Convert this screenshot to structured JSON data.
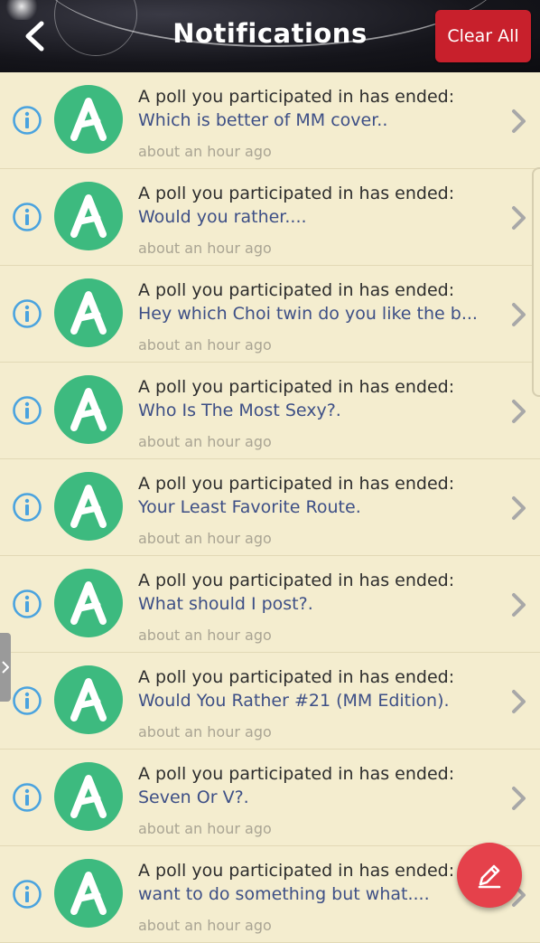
{
  "header": {
    "title": "Notifications",
    "clear_label": "Clear All"
  },
  "notifications": [
    {
      "message": "A poll you participated in has ended:",
      "poll_title": "Which is better of MM cover..",
      "time": "about an hour ago"
    },
    {
      "message": "A poll you participated in has ended:",
      "poll_title": "Would you rather....",
      "time": "about an hour ago"
    },
    {
      "message": "A poll you participated in has ended:",
      "poll_title": "Hey which Choi twin do you like the b...",
      "time": "about an hour ago"
    },
    {
      "message": "A poll you participated in has ended:",
      "poll_title": "Who Is The Most Sexy?.",
      "time": "about an hour ago"
    },
    {
      "message": "A poll you participated in has ended:",
      "poll_title": "Your Least Favorite Route.",
      "time": "about an hour ago"
    },
    {
      "message": "A poll you participated in has ended:",
      "poll_title": "What should I post?.",
      "time": "about an hour ago"
    },
    {
      "message": "A poll you participated in has ended:",
      "poll_title": "Would You Rather #21 (MM Edition).",
      "time": "about an hour ago"
    },
    {
      "message": "A poll you participated in has ended:",
      "poll_title": "Seven Or V?.",
      "time": "about an hour ago"
    },
    {
      "message": "A poll you participated in has ended:",
      "poll_title": "want to do something but what....",
      "time": "about an hour ago"
    }
  ],
  "icons": {
    "back": "back-arrow-icon",
    "info": "info-icon",
    "avatar": "amino-logo-icon",
    "chevron": "chevron-right-icon",
    "fab": "pencil-icon"
  },
  "colors": {
    "header_bg": "#15151b",
    "clear_button": "#c8202c",
    "list_bg": "#f4edcf",
    "avatar": "#3dba7f",
    "info": "#4aa3df",
    "poll_title": "#3d4f86",
    "time": "#a9a493",
    "fab": "#e5414b"
  }
}
